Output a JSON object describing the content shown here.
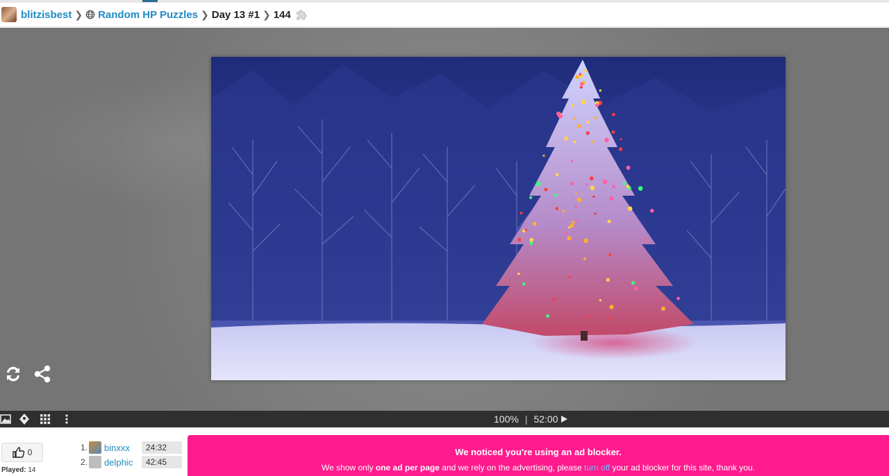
{
  "header": {
    "username": "blitzisbest",
    "collection": "Random HP Puzzles",
    "puzzle_name": "Day 13 #1",
    "piece_count": "144"
  },
  "toolbar": {
    "zoom": "100%",
    "timer": "52:00"
  },
  "likes": {
    "count": "0",
    "played_label": "Played:",
    "played_count": "14"
  },
  "scores": [
    {
      "rank": "1.",
      "name": "binxxx",
      "time": "24:32"
    },
    {
      "rank": "2.",
      "name": "delphic",
      "time": "42:45"
    }
  ],
  "ad_banner": {
    "title": "We noticed you're using an ad blocker.",
    "text_1": "We show only ",
    "text_bold": "one ad per page",
    "text_2": " and we rely on the advertising, please ",
    "link": "turn off",
    "text_3": " your ad blocker for this site, thank you.",
    "color": "#ff1b8d"
  },
  "colors": {
    "link": "#1e8bc3",
    "toolbar_bg": "#2f2f2f",
    "stage_bg": "#7d7d7d"
  },
  "icons": {
    "refresh": "refresh-icon",
    "share": "share-icon",
    "image": "image-icon",
    "ghost": "ghost-icon",
    "grid": "grid-icon",
    "menu": "more-vertical-icon",
    "like": "thumbs-up-icon",
    "play": "play-icon"
  }
}
